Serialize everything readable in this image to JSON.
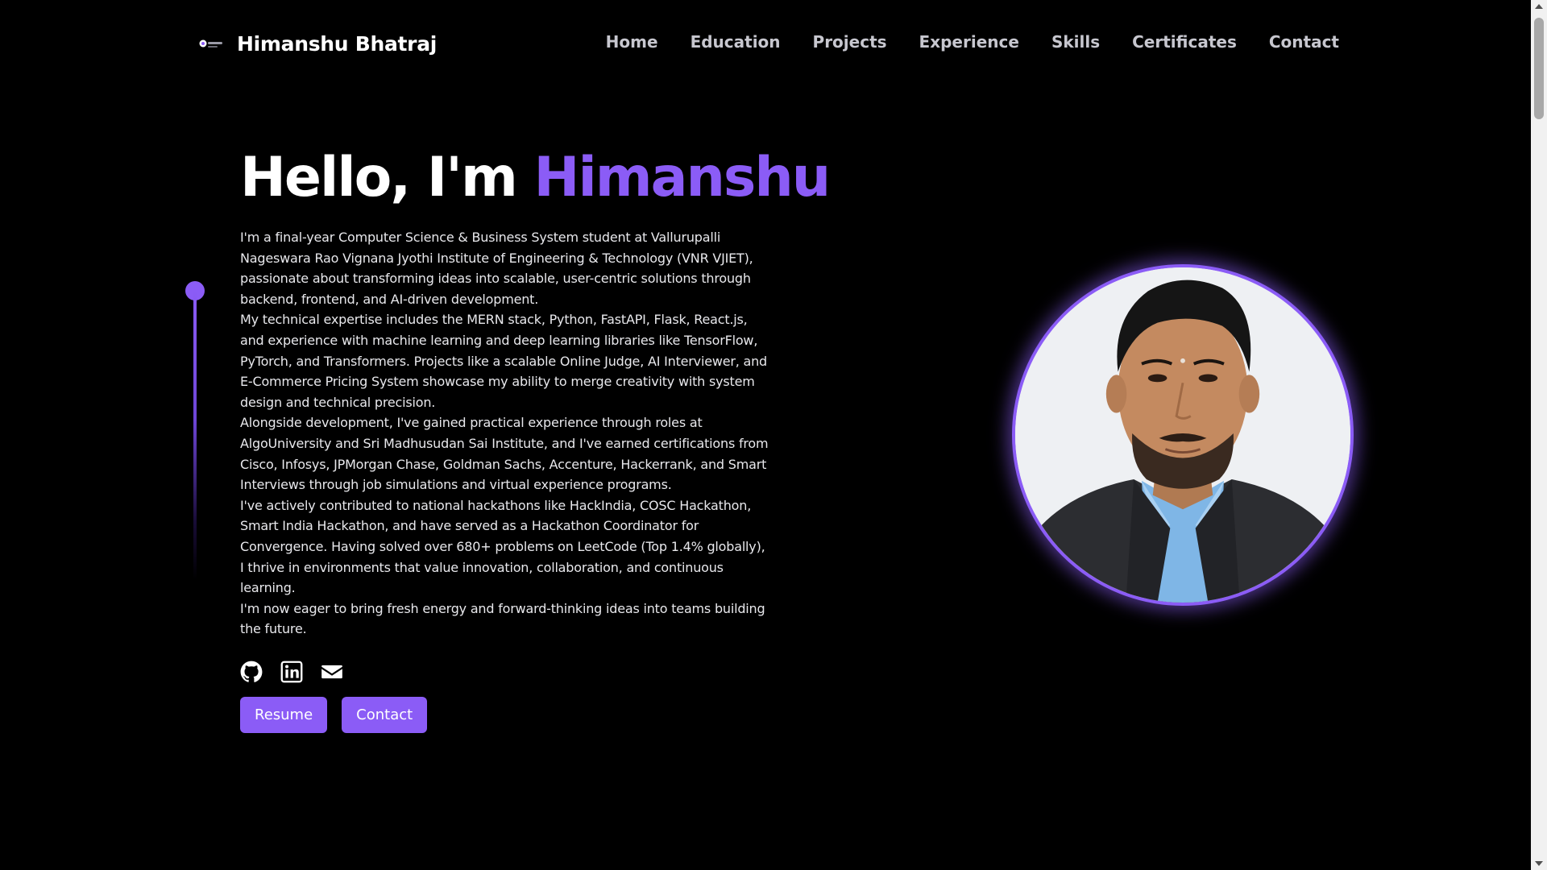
{
  "nav": {
    "brand_name": "Himanshu Bhatraj",
    "brand_logo_icon": "hb-logo-icon",
    "links": [
      {
        "label": "Home"
      },
      {
        "label": "Education"
      },
      {
        "label": "Projects"
      },
      {
        "label": "Experience"
      },
      {
        "label": "Skills"
      },
      {
        "label": "Certificates"
      },
      {
        "label": "Contact"
      }
    ]
  },
  "hero": {
    "greeting": "Hello, I'm",
    "name": "Himanshu",
    "bio": [
      "I'm a final-year Computer Science & Business System student at Vallurupalli Nageswara Rao Vignana Jyothi Institute of Engineering & Technology (VNR VJIET), passionate about transforming ideas into scalable, user-centric solutions through backend, frontend, and AI-driven development.",
      "My technical expertise includes the MERN stack, Python, FastAPI, Flask, React.js, and experience with machine learning and deep learning libraries like TensorFlow, PyTorch, and Transformers. Projects like a scalable Online Judge, AI Interviewer, and E-Commerce Pricing System showcase my ability to merge creativity with system design and technical precision.",
      "Alongside development, I've gained practical experience through roles at AlgoUniversity and Sri Madhusudan Sai Institute, and I've earned certifications from Cisco, Infosys, JPMorgan Chase, Goldman Sachs, Accenture, Hackerrank, and Smart Interviews through job simulations and virtual experience programs.",
      "I've actively contributed to national hackathons like HackIndia, COSC Hackathon, Smart India Hackathon, and have served as a Hackathon Coordinator for Convergence. Having solved over 680+ problems on LeetCode (Top 1.4% globally), I thrive in environments that value innovation, collaboration, and continuous learning.",
      "I'm now eager to bring fresh energy and forward-thinking ideas into teams building the future."
    ],
    "socials": [
      {
        "icon": "github-icon"
      },
      {
        "icon": "linkedin-icon"
      },
      {
        "icon": "mail-icon"
      }
    ],
    "buttons": {
      "resume_label": "Resume",
      "contact_label": "Contact"
    },
    "avatar_icon": "profile-photo"
  },
  "colors": {
    "background": "#000000",
    "accent": "#8b5cf6",
    "nav_text": "#c7c7cf",
    "body_text": "#e8e8ec"
  }
}
